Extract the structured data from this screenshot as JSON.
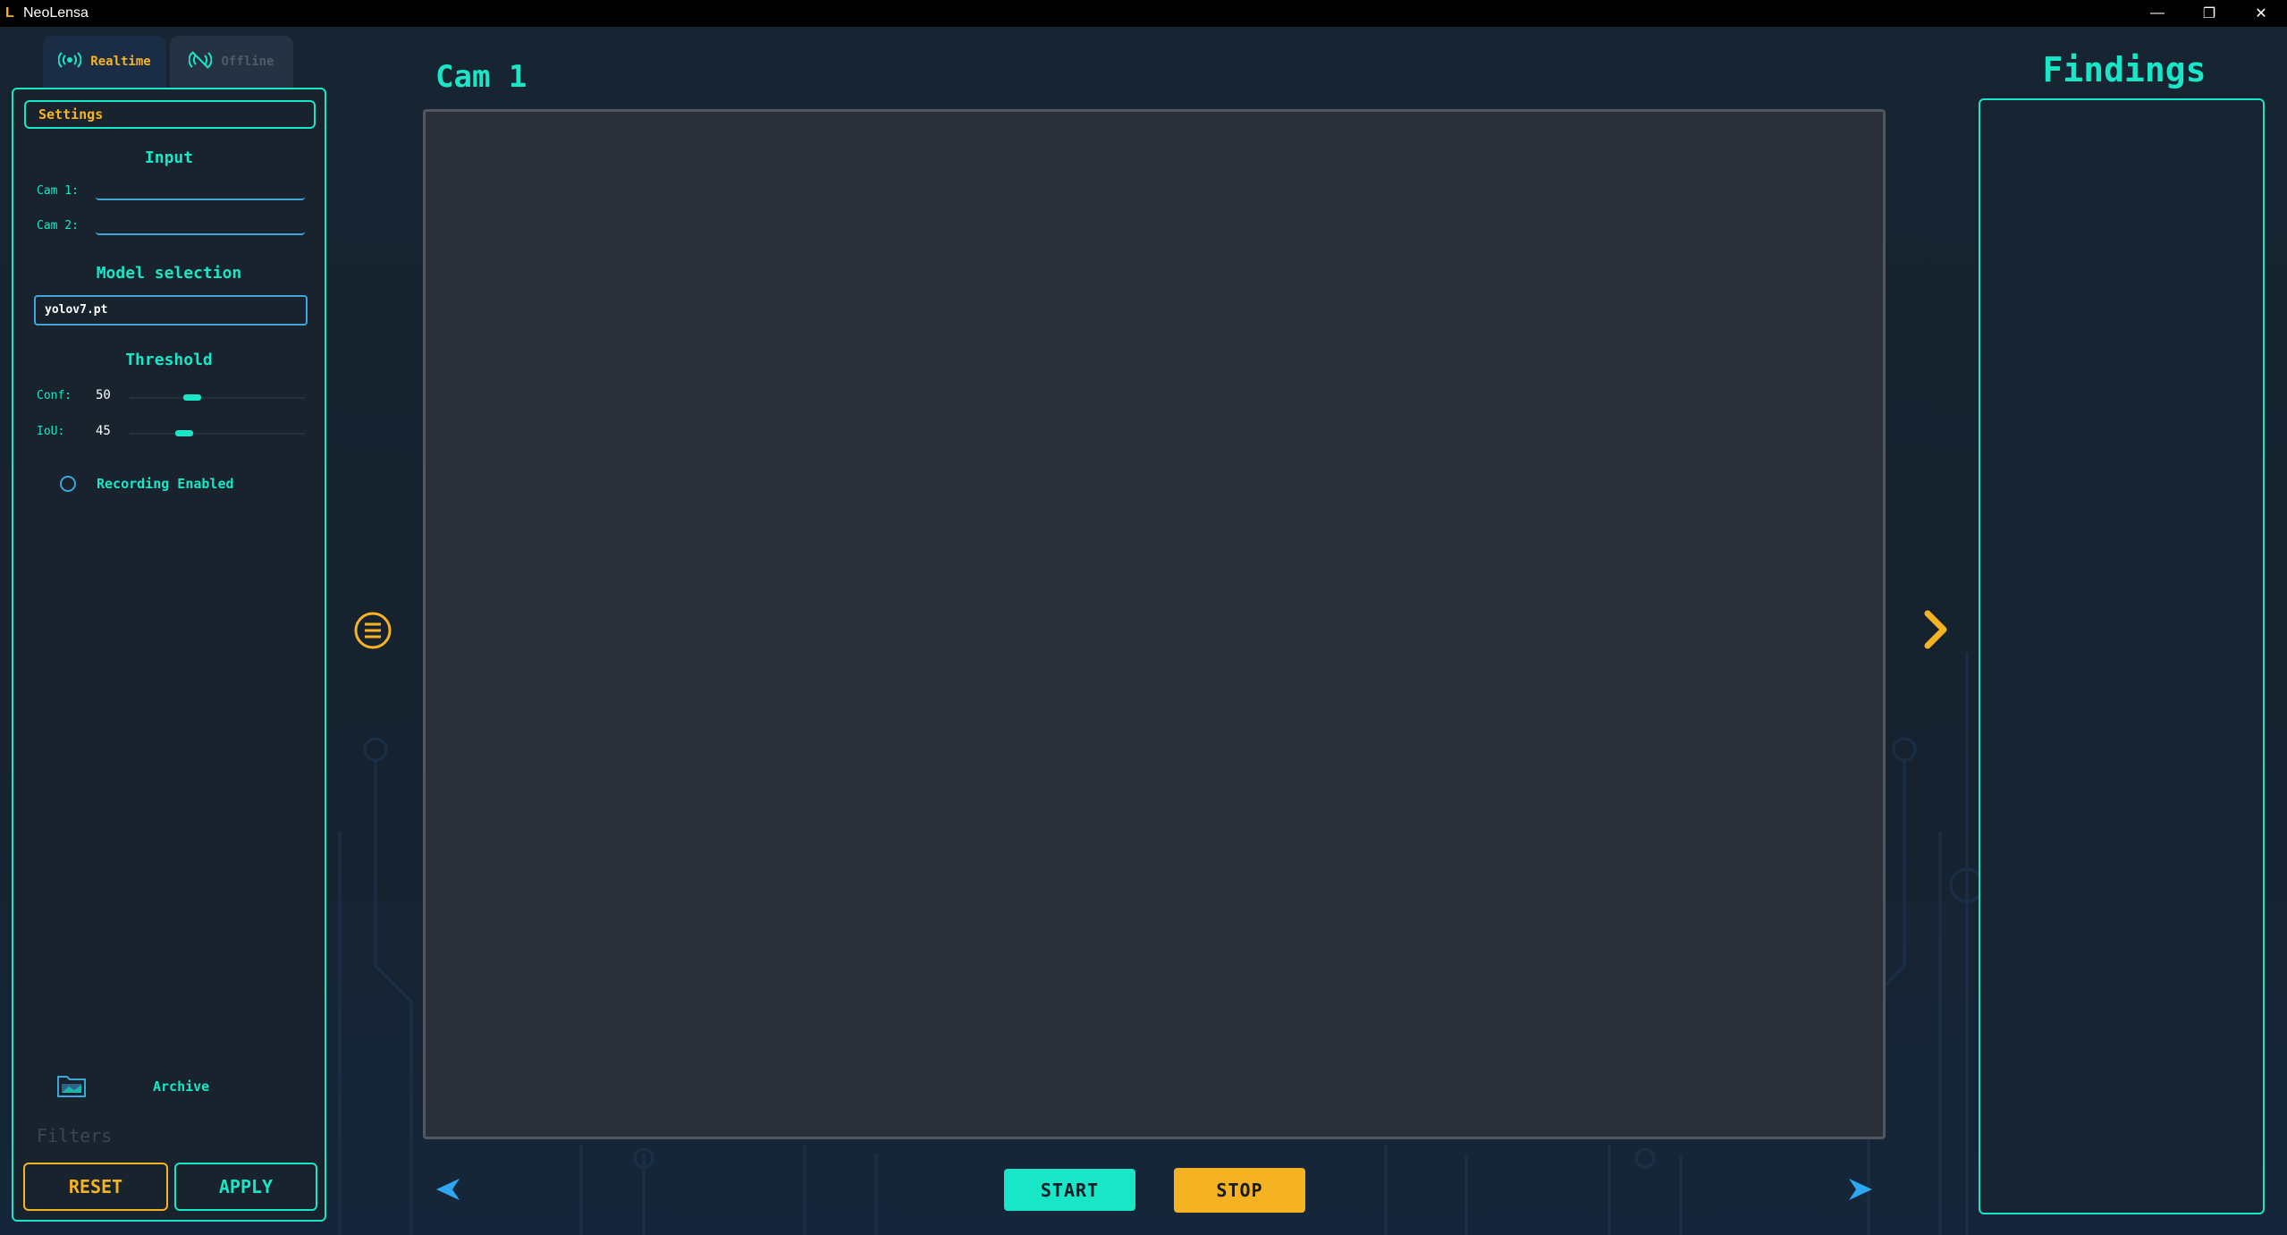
{
  "window": {
    "title": "NeoLensa",
    "logo_letter": "L",
    "minimize": "—",
    "restore": "❐",
    "close": "✕"
  },
  "mode_tabs": [
    {
      "label": "Realtime",
      "icon": "broadcast-icon",
      "active": true
    },
    {
      "label": "Offline",
      "icon": "broadcast-off-icon",
      "active": false
    }
  ],
  "settings": {
    "header": "Settings",
    "input": {
      "title": "Input",
      "cam1_label": "Cam 1:",
      "cam1_value": "",
      "cam2_label": "Cam 2:",
      "cam2_value": ""
    },
    "model": {
      "title": "Model selection",
      "value": "yolov7.pt"
    },
    "threshold": {
      "title": "Threshold",
      "conf_label": "Conf:",
      "conf_value": "50",
      "conf": 50,
      "iou_label": "IoU:",
      "iou_value": "45",
      "iou": 45
    },
    "recording_label": "Recording Enabled",
    "recording_enabled": false
  },
  "archive": {
    "label": "Archive",
    "icon": "archive-folder-icon"
  },
  "filters_label": "Filters",
  "actions": {
    "reset": "RESET",
    "apply": "APPLY"
  },
  "main": {
    "cam_title": "Cam 1",
    "start": "START",
    "stop": "STOP"
  },
  "findings": {
    "title": "Findings"
  },
  "colors": {
    "accent_teal": "#19e6c6",
    "accent_orange": "#f5b324",
    "accent_blue": "#3ea6d9",
    "background": "#172431"
  }
}
